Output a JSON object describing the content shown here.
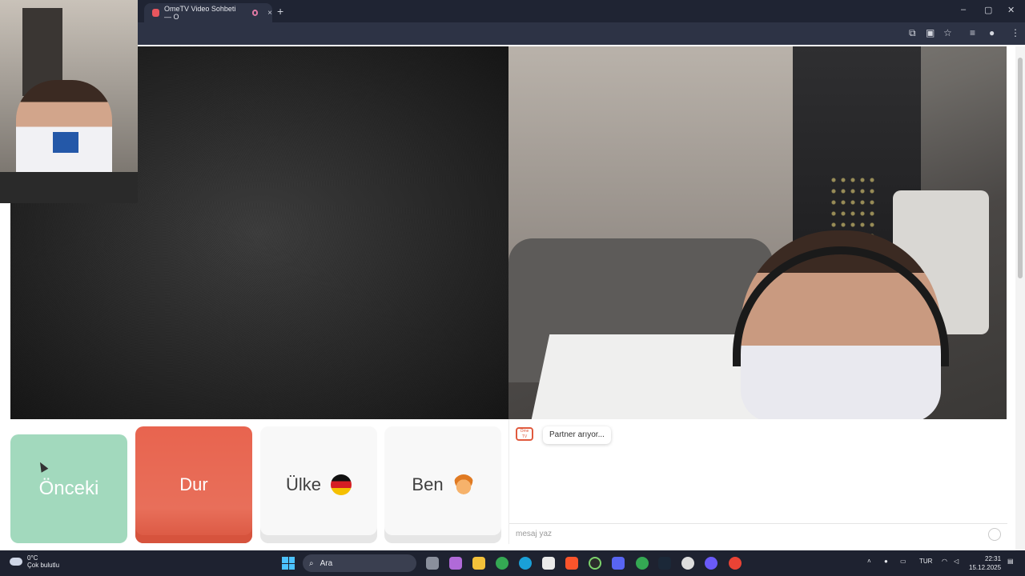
{
  "browser": {
    "tab_title": "OmeTV Video Sohbeti — O",
    "new_tab_symbol": "+",
    "close_symbol": "×",
    "window_controls": [
      "–",
      "▢",
      "✕"
    ]
  },
  "chat": {
    "partner_status": "Partner arıyor...",
    "message_placeholder": "mesaj yaz",
    "logo_text": "Ome TV"
  },
  "buttons": {
    "previous": "Önceki",
    "stop": "Dur",
    "country": "Ülke",
    "gender": "Ben"
  },
  "taskbar": {
    "temperature": "0°C",
    "weather": "Çok bulutlu",
    "search_placeholder": "Ara",
    "language": "TUR",
    "time": "22:31",
    "date": "15.12.2025"
  },
  "colors": {
    "previous_button": "#a2d9bd",
    "stop_button": "#e8644f",
    "titlebar": "#1f2433",
    "taskbar": "#1e2230"
  }
}
